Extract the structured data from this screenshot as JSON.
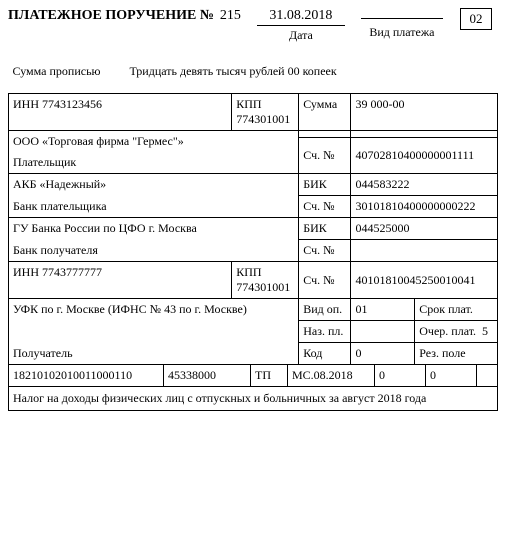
{
  "header": {
    "title": "ПЛАТЕЖНОЕ ПОРУЧЕНИЕ №",
    "number": "215",
    "date": "31.08.2018",
    "date_label": "Дата",
    "type_value": "",
    "type_label": "Вид платежа",
    "code": "02"
  },
  "summa_prop": {
    "label": "Сумма прописью",
    "value": "Тридцать девять тысяч рублей 00 копеек"
  },
  "payer": {
    "inn_label": "ИНН",
    "inn": "7743123456",
    "kpp_label": "КПП",
    "kpp": "774301001",
    "summa_label": "Сумма",
    "summa": "39 000-00",
    "name": "ООО «Торговая фирма \"Гермес\"»",
    "acc_label": "Сч. №",
    "acc": "40702810400000001111",
    "role_label": "Плательщик"
  },
  "payer_bank": {
    "name": "АКБ «Надежный»",
    "bik_label": "БИК",
    "bik": "044583222",
    "acc_label": "Сч. №",
    "acc": "30101810400000000222",
    "role_label": "Банк плательщика"
  },
  "recip_bank": {
    "name": "ГУ Банка России по ЦФО г. Москва",
    "bik_label": "БИК",
    "bik": "044525000",
    "acc_label": "Сч. №",
    "acc": "",
    "role_label": "Банк получателя"
  },
  "recip": {
    "inn_label": "ИНН",
    "inn": "7743777777",
    "kpp_label": "КПП",
    "kpp": "774301001",
    "acc_label": "Сч. №",
    "acc": "40101810045250010041",
    "name": "УФК по г. Москве (ИФНС № 43 по г. Москве)",
    "role_label": "Получатель"
  },
  "ops": {
    "vidop_label": "Вид оп.",
    "vidop": "01",
    "srok_label": "Срок плат.",
    "srok": "",
    "nazpl_label": "Наз. пл.",
    "nazpl": "",
    "ocher_label": "Очер. плат.",
    "ocher": "5",
    "kod_label": "Код",
    "kod": "0",
    "rez_label": "Рез. поле",
    "rez": ""
  },
  "bottom": {
    "f1": "18210102010011000110",
    "f2": "45338000",
    "f3_label": "ТП",
    "f4": "МС.08.2018",
    "f5": "0",
    "f6": "0",
    "f7": ""
  },
  "purpose": "Налог на доходы физических лиц с отпускных и больничных за август 2018 года"
}
